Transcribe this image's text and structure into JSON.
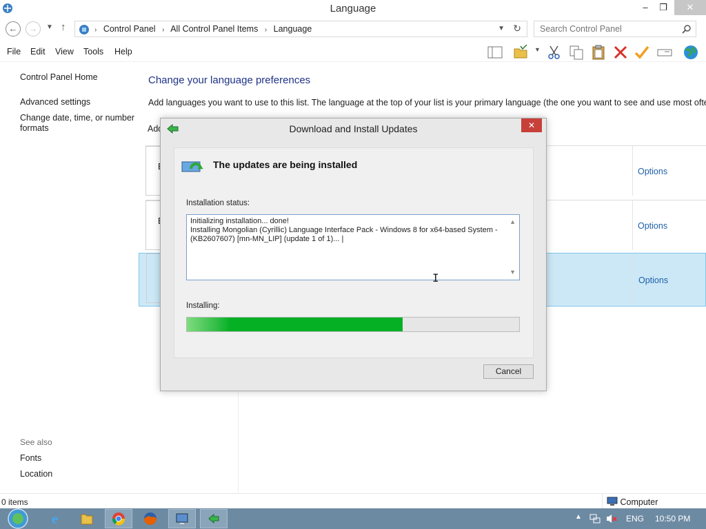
{
  "window": {
    "title": "Language",
    "controls": {
      "minimize": "–",
      "restore": "❐",
      "close": "✕"
    }
  },
  "address": {
    "back": "←",
    "forward": "→",
    "up": "↑",
    "crumbs": [
      "Control Panel",
      "All Control Panel Items",
      "Language"
    ],
    "separator": "›",
    "search_placeholder": "Search Control Panel"
  },
  "menu": {
    "items": [
      "File",
      "Edit",
      "View",
      "Tools",
      "Help"
    ]
  },
  "toolbar": {
    "icons": [
      "layout-pane-icon",
      "properties-folder-icon",
      "cut-icon",
      "copy-icon",
      "paste-icon",
      "delete-icon",
      "checkmark-icon",
      "rename-icon",
      "globe-icon"
    ]
  },
  "left_nav": {
    "home": "Control Panel Home",
    "advanced": "Advanced settings",
    "datetime_line1": "Change date, time, or number",
    "datetime_line2": "formats",
    "see_also": "See also",
    "fonts": "Fonts",
    "location": "Location"
  },
  "main": {
    "heading": "Change your language preferences",
    "description": "Add languages you want to use to this list. The language at the top of your list is your primary language (the one you want to see and use most often).",
    "add_link_fragment": "Add",
    "rows": [
      {
        "letter": "E",
        "options": "Options"
      },
      {
        "letter": "E",
        "options": "Options"
      },
      {
        "letter": "",
        "options": "Options"
      }
    ]
  },
  "dialog": {
    "title": "Download and Install Updates",
    "close": "✕",
    "header": "The updates are being installed",
    "status_label": "Installation status:",
    "status_lines": [
      "Initializing installation... done!",
      "Installing Mongolian (Cyrillic) Language Interface Pack - Windows 8 for x64-based System -",
      "(KB2607607) [mn-MN_LIP] (update 1 of 1)... |"
    ],
    "progress_label": "Installing:",
    "progress_percent": 65,
    "cancel": "Cancel",
    "colors": {
      "progress": "#06b025",
      "close": "#c7403a"
    }
  },
  "status_bar": {
    "items": "0 items",
    "zone": "Computer"
  },
  "taskbar": {
    "language": "ENG",
    "time": "10:50 PM",
    "apps": [
      "start-orb-icon",
      "internet-explorer-icon",
      "file-explorer-icon",
      "chrome-icon",
      "firefox-icon",
      "control-panel-icon",
      "windows-update-icon"
    ],
    "tray": [
      "show-hidden-icons-icon",
      "network-icon",
      "volume-muted-icon"
    ]
  }
}
